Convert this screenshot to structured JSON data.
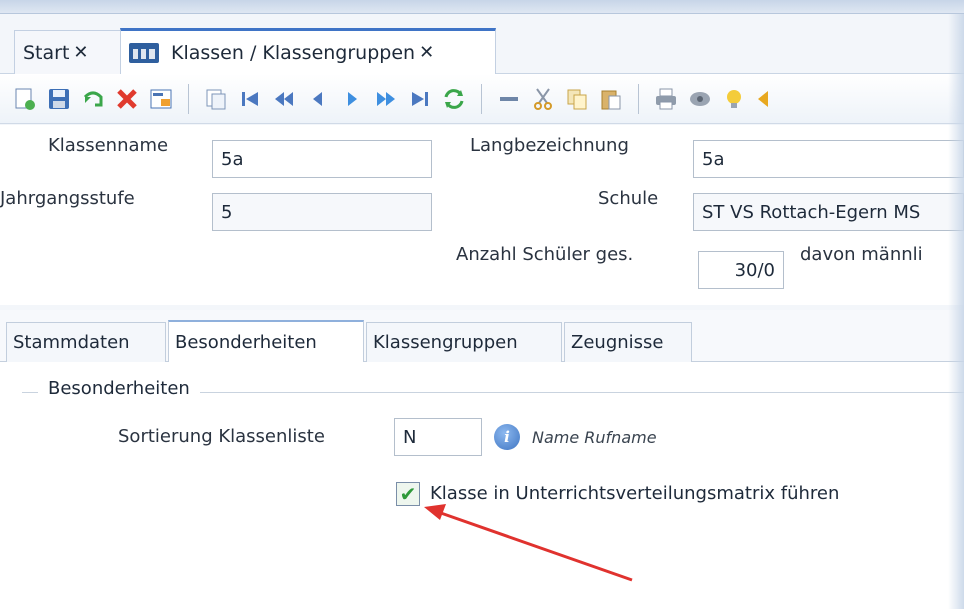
{
  "tabs": {
    "start_label": "Start",
    "close_glyph": "✕",
    "active_label": "Klassen / Klassengruppen"
  },
  "toolbar": {
    "icons": [
      "new-document-icon",
      "save-icon",
      "undo-icon",
      "delete-icon",
      "edit-form-icon",
      "copy-record-icon",
      "first-record-icon",
      "fast-back-icon",
      "previous-icon",
      "next-icon",
      "fast-forward-icon",
      "last-record-icon",
      "refresh-icon",
      "minus-icon",
      "cut-icon",
      "copy-icon",
      "paste-icon",
      "print-icon",
      "preview-icon",
      "hint-bulb-icon",
      "arrow-icon"
    ]
  },
  "form": {
    "klassenname_label": "Klassenname",
    "klassenname_value": "5a",
    "langbezeichnung_label": "Langbezeichnung",
    "langbezeichnung_value": "5a",
    "jahrgangsstufe_label": "Jahrgangsstufe",
    "jahrgangsstufe_value": "5",
    "schule_label": "Schule",
    "schule_value": "ST VS Rottach-Egern MS",
    "anzahl_label": "Anzahl Schüler ges.",
    "anzahl_value": "30/0",
    "davon_label": "davon männli"
  },
  "subtabs": {
    "stammdaten": "Stammdaten",
    "besonderheiten": "Besonderheiten",
    "klassengruppen": "Klassengruppen",
    "zeugnisse": "Zeugnisse"
  },
  "panel": {
    "group_title": "Besonderheiten",
    "sortierung_label": "Sortierung Klassenliste",
    "sortierung_value": "N",
    "hint_text": "Name Rufname",
    "checkbox_label": "Klasse in Unterrichtsverteilungsmatrix führen",
    "checkbox_checked": true
  },
  "colors": {
    "accent": "#3f74c6",
    "arrow": "#e0322e",
    "check": "#2f9a3a"
  }
}
